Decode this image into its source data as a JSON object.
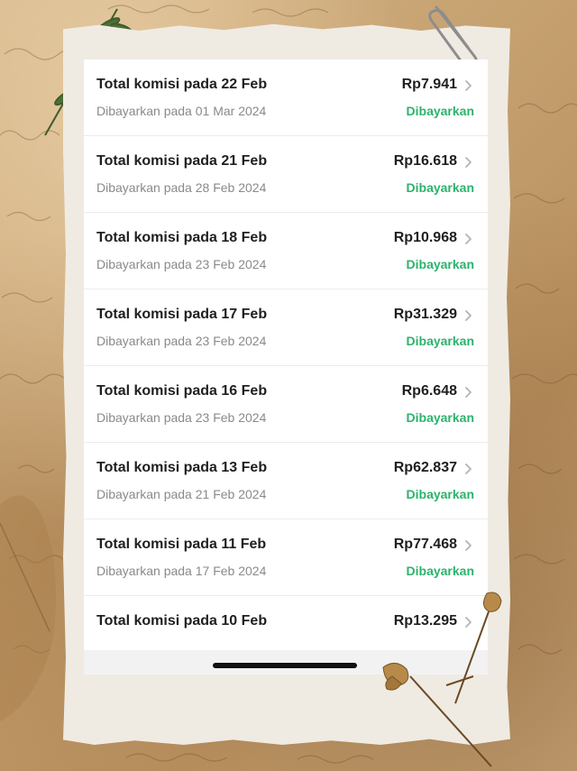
{
  "commissions": [
    {
      "title": "Total komisi pada 22 Feb",
      "subtitle": "Dibayarkan pada 01 Mar 2024",
      "amount": "Rp7.941",
      "status": "Dibayarkan"
    },
    {
      "title": "Total komisi pada 21 Feb",
      "subtitle": "Dibayarkan pada 28 Feb 2024",
      "amount": "Rp16.618",
      "status": "Dibayarkan"
    },
    {
      "title": "Total komisi pada 18 Feb",
      "subtitle": "Dibayarkan pada 23 Feb 2024",
      "amount": "Rp10.968",
      "status": "Dibayarkan"
    },
    {
      "title": "Total komisi pada 17 Feb",
      "subtitle": "Dibayarkan pada 23 Feb 2024",
      "amount": "Rp31.329",
      "status": "Dibayarkan"
    },
    {
      "title": "Total komisi pada 16 Feb",
      "subtitle": "Dibayarkan pada 23 Feb 2024",
      "amount": "Rp6.648",
      "status": "Dibayarkan"
    },
    {
      "title": "Total komisi pada 13 Feb",
      "subtitle": "Dibayarkan pada 21 Feb 2024",
      "amount": "Rp62.837",
      "status": "Dibayarkan"
    },
    {
      "title": "Total komisi pada 11 Feb",
      "subtitle": "Dibayarkan pada 17 Feb 2024",
      "amount": "Rp77.468",
      "status": "Dibayarkan"
    },
    {
      "title": "Total komisi pada 10 Feb",
      "amount": "Rp13.295"
    }
  ],
  "icons": {
    "row_chevron": "chevron-right-icon",
    "paperclip": "paperclip-icon",
    "fern": "fern-leaf-icon",
    "dried_flower": "dried-flower-icon"
  },
  "colors": {
    "paid_status": "#2bb36b",
    "primary_text": "#1f1f1f",
    "secondary_text": "#8a8a8a",
    "paper": "#efebe3",
    "background": "#c9a97a"
  }
}
